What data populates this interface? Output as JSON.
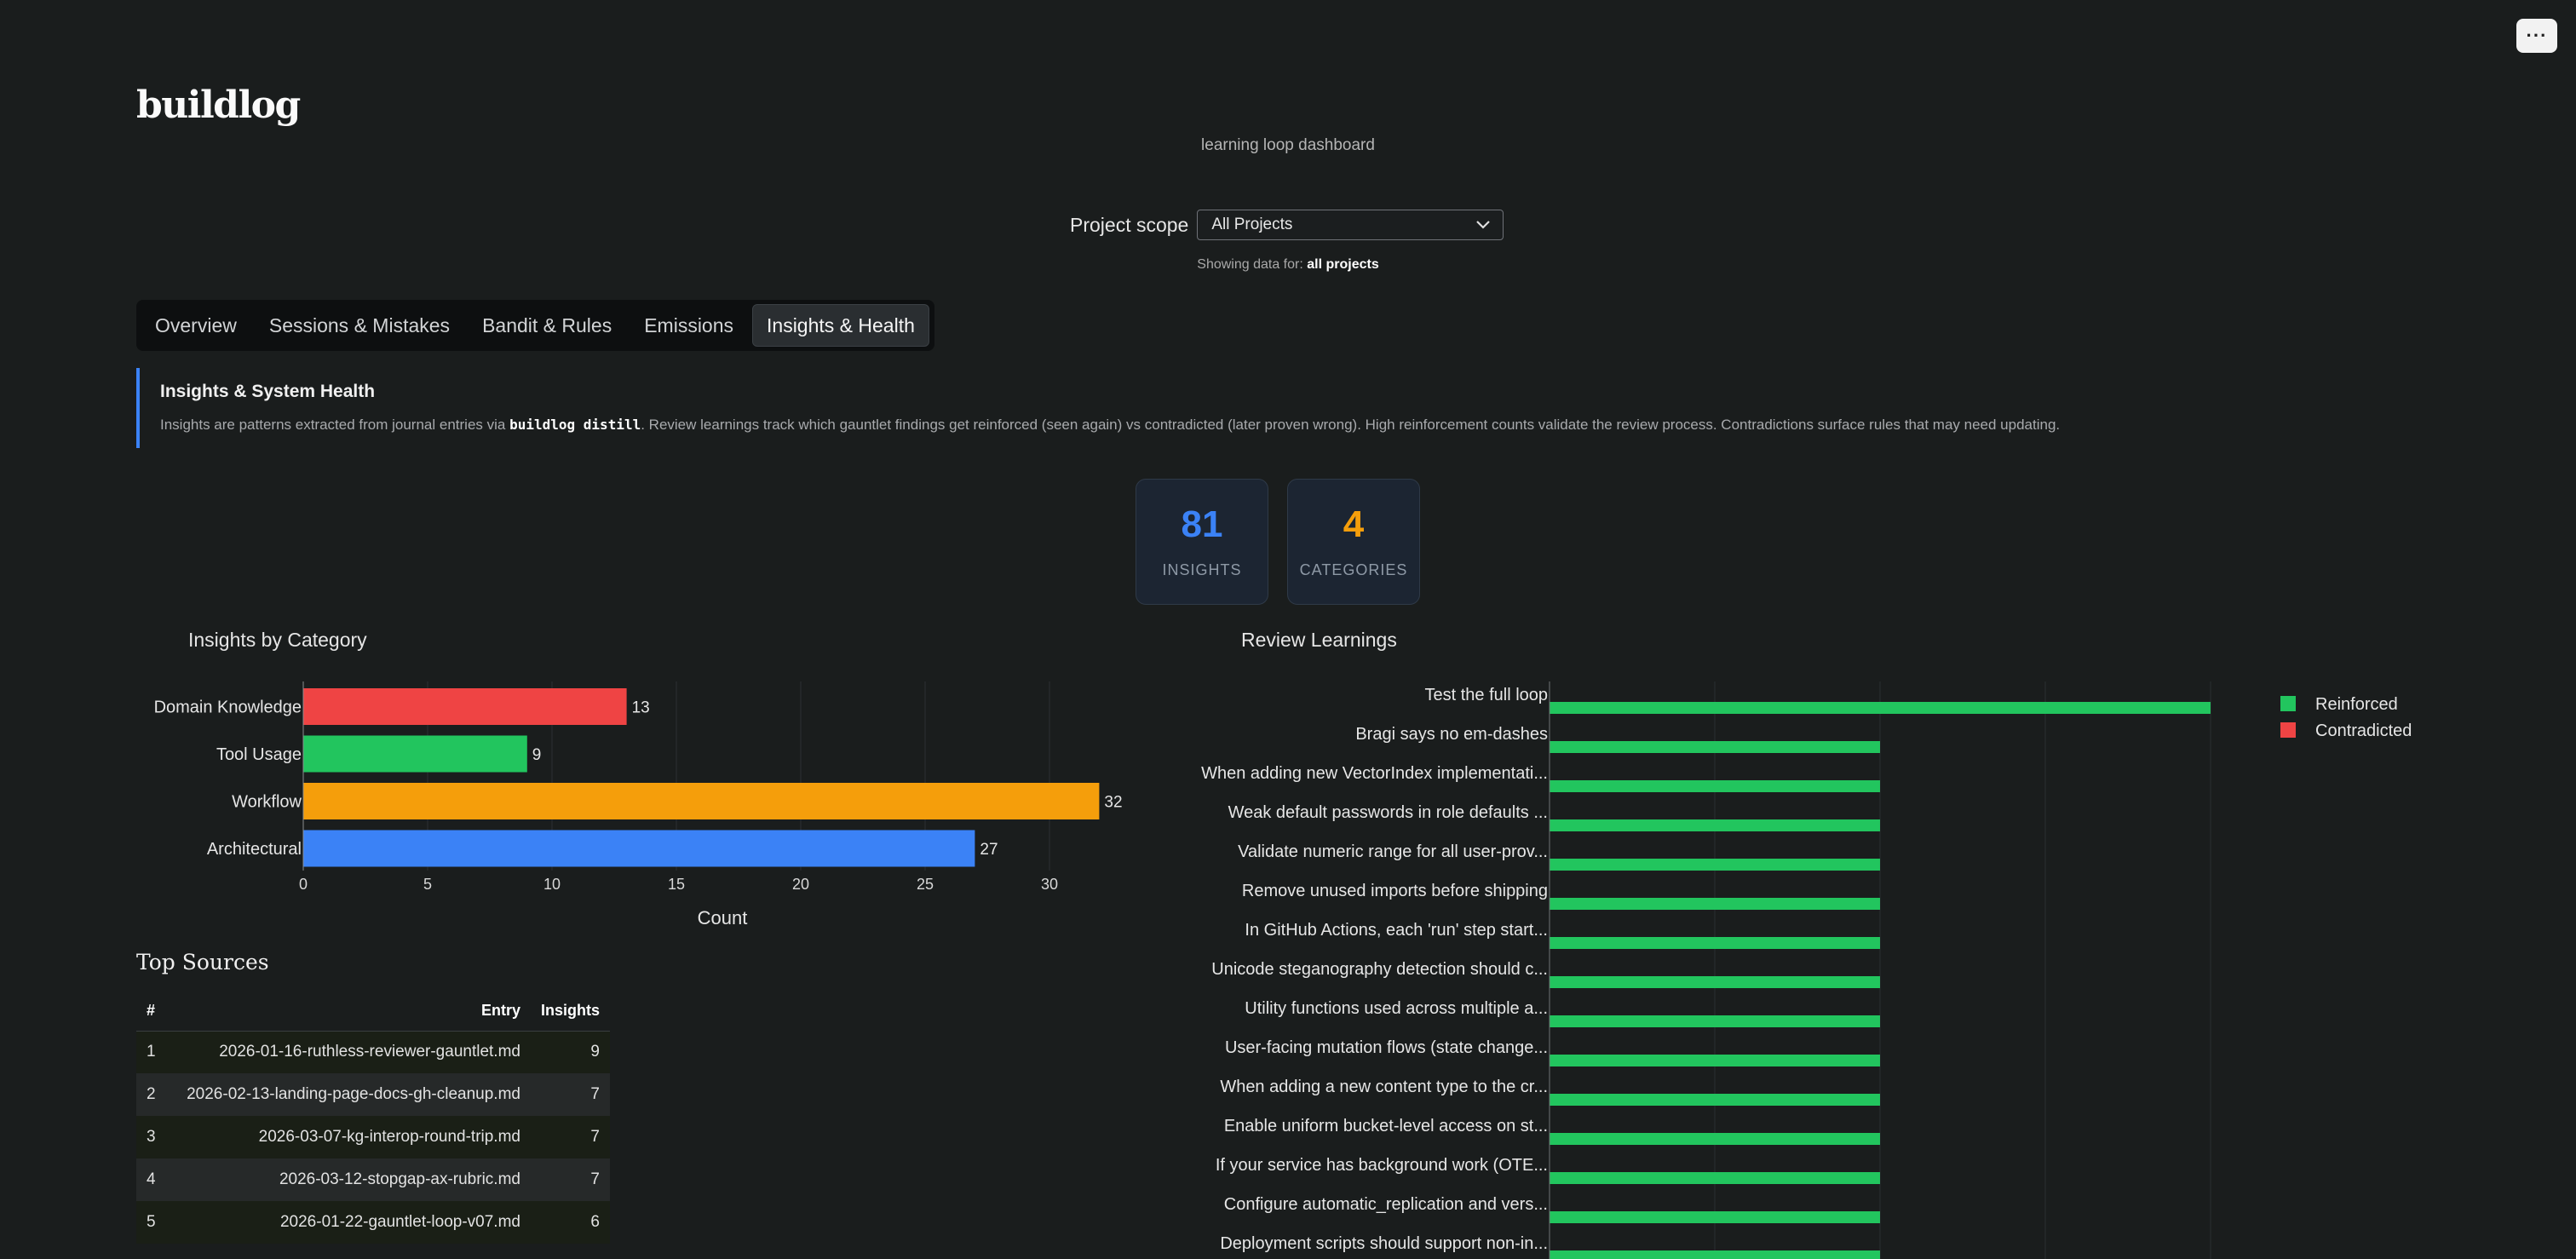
{
  "app": {
    "logo": "buildlog",
    "subtitle": "learning loop dashboard",
    "menu_icon": "···"
  },
  "scope": {
    "label": "Project scope",
    "selected": "All Projects",
    "showing_prefix": "Showing data for:",
    "showing_value": "all projects"
  },
  "tabs": [
    {
      "label": "Overview",
      "active": false
    },
    {
      "label": "Sessions & Mistakes",
      "active": false
    },
    {
      "label": "Bandit & Rules",
      "active": false
    },
    {
      "label": "Emissions",
      "active": false
    },
    {
      "label": "Insights & Health",
      "active": true
    }
  ],
  "info": {
    "title": "Insights & System Health",
    "text_before": "Insights are patterns extracted from journal entries via ",
    "code": "buildlog distill",
    "text_after": ". Review learnings track which gauntlet findings get reinforced (seen again) vs contradicted (later proven wrong). High reinforcement counts validate the review process. Contradictions surface rules that may need updating."
  },
  "stats": [
    {
      "value": "81",
      "label": "INSIGHTS",
      "color": "#3b82f6"
    },
    {
      "value": "4",
      "label": "CATEGORIES",
      "color": "#f59e0b"
    }
  ],
  "chart_data": [
    {
      "type": "bar",
      "orientation": "horizontal",
      "title": "Insights by Category",
      "categories": [
        "Domain Knowledge",
        "Tool Usage",
        "Workflow",
        "Architectural"
      ],
      "values": [
        13,
        9,
        32,
        27
      ],
      "colors": [
        "#ef4444",
        "#22c55e",
        "#f59e0b",
        "#3b82f6"
      ],
      "xlabel": "Count",
      "xticks": [
        0,
        5,
        10,
        15,
        20,
        25,
        30
      ],
      "xlim": [
        0,
        33
      ],
      "data_labels": true,
      "grid": true
    },
    {
      "type": "bar",
      "orientation": "horizontal",
      "title": "Review Learnings",
      "categories": [
        "Test the full loop",
        "Bragi says no em-dashes",
        "When adding new VectorIndex implementati...",
        "Weak default passwords in role defaults ...",
        "Validate numeric range for all user-prov...",
        "Remove unused imports before shipping",
        "In GitHub Actions, each 'run' step start...",
        "Unicode steganography detection should c...",
        "Utility functions used across multiple a...",
        "User-facing mutation flows (state change...",
        "When adding a new content type to the cr...",
        "Enable uniform bucket-level access on st...",
        "If your service has background work (OTE...",
        "Configure automatic_replication and vers...",
        "Deployment scripts should support non-in..."
      ],
      "series": [
        {
          "name": "Reinforced",
          "color": "#22c55e",
          "values": [
            2,
            1,
            1,
            1,
            1,
            1,
            1,
            1,
            1,
            1,
            1,
            1,
            1,
            1,
            1
          ]
        },
        {
          "name": "Contradicted",
          "color": "#ef4444",
          "values": [
            0,
            0,
            0,
            0,
            0,
            0,
            0,
            0,
            0,
            0,
            0,
            0,
            0,
            0,
            0
          ]
        }
      ],
      "xlim": [
        0,
        2
      ],
      "legend": "top-right",
      "grid": true
    }
  ],
  "sources": {
    "title": "Top Sources",
    "headers": {
      "num": "#",
      "entry": "Entry",
      "insights": "Insights"
    },
    "rows": [
      {
        "num": "1",
        "entry": "2026-01-16-ruthless-reviewer-gauntlet.md",
        "insights": "9"
      },
      {
        "num": "2",
        "entry": "2026-02-13-landing-page-docs-gh-cleanup.md",
        "insights": "7"
      },
      {
        "num": "3",
        "entry": "2026-03-07-kg-interop-round-trip.md",
        "insights": "7"
      },
      {
        "num": "4",
        "entry": "2026-03-12-stopgap-ax-rubric.md",
        "insights": "7"
      },
      {
        "num": "5",
        "entry": "2026-01-22-gauntlet-loop-v07.md",
        "insights": "6"
      }
    ]
  }
}
